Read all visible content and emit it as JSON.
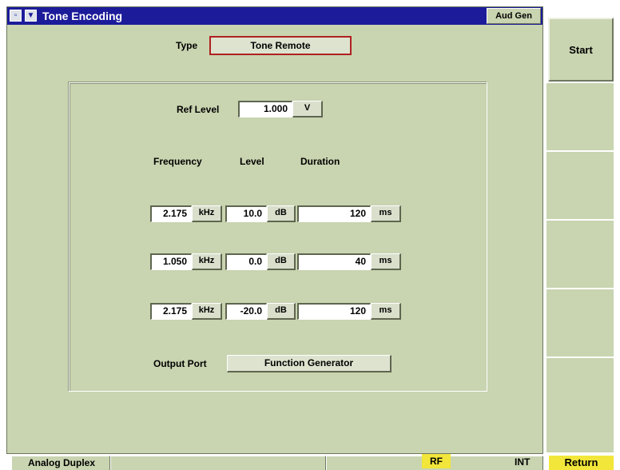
{
  "window": {
    "title": "Tone Encoding",
    "mode_tab": "Aud Gen",
    "restore_icon": "restore-icon",
    "menu_icon": "menu-down-arrow-icon"
  },
  "type": {
    "label": "Type",
    "value": "Tone Remote"
  },
  "ref_level": {
    "label": "Ref Level",
    "value": "1.000",
    "unit": "V"
  },
  "columns": {
    "frequency": "Frequency",
    "level": "Level",
    "duration": "Duration"
  },
  "tones": [
    {
      "frequency": "2.175",
      "frequency_unit": "kHz",
      "level": "10.0",
      "level_unit": "dB",
      "duration": "120",
      "duration_unit": "ms"
    },
    {
      "frequency": "1.050",
      "frequency_unit": "kHz",
      "level": "0.0",
      "level_unit": "dB",
      "duration": "40",
      "duration_unit": "ms"
    },
    {
      "frequency": "2.175",
      "frequency_unit": "kHz",
      "level": "-20.0",
      "level_unit": "dB",
      "duration": "120",
      "duration_unit": "ms"
    }
  ],
  "output_port": {
    "label": "Output Port",
    "value": "Function Generator"
  },
  "softkeys": {
    "start": "Start",
    "return": "Return"
  },
  "statusbar": {
    "mode": "Analog Duplex",
    "rf": "RF",
    "ref": "INT"
  },
  "colors": {
    "panel": "#c9d4b0",
    "titlebar": "#1c1c9a",
    "highlight": "#f2e63a",
    "selected_border": "#b02020"
  }
}
